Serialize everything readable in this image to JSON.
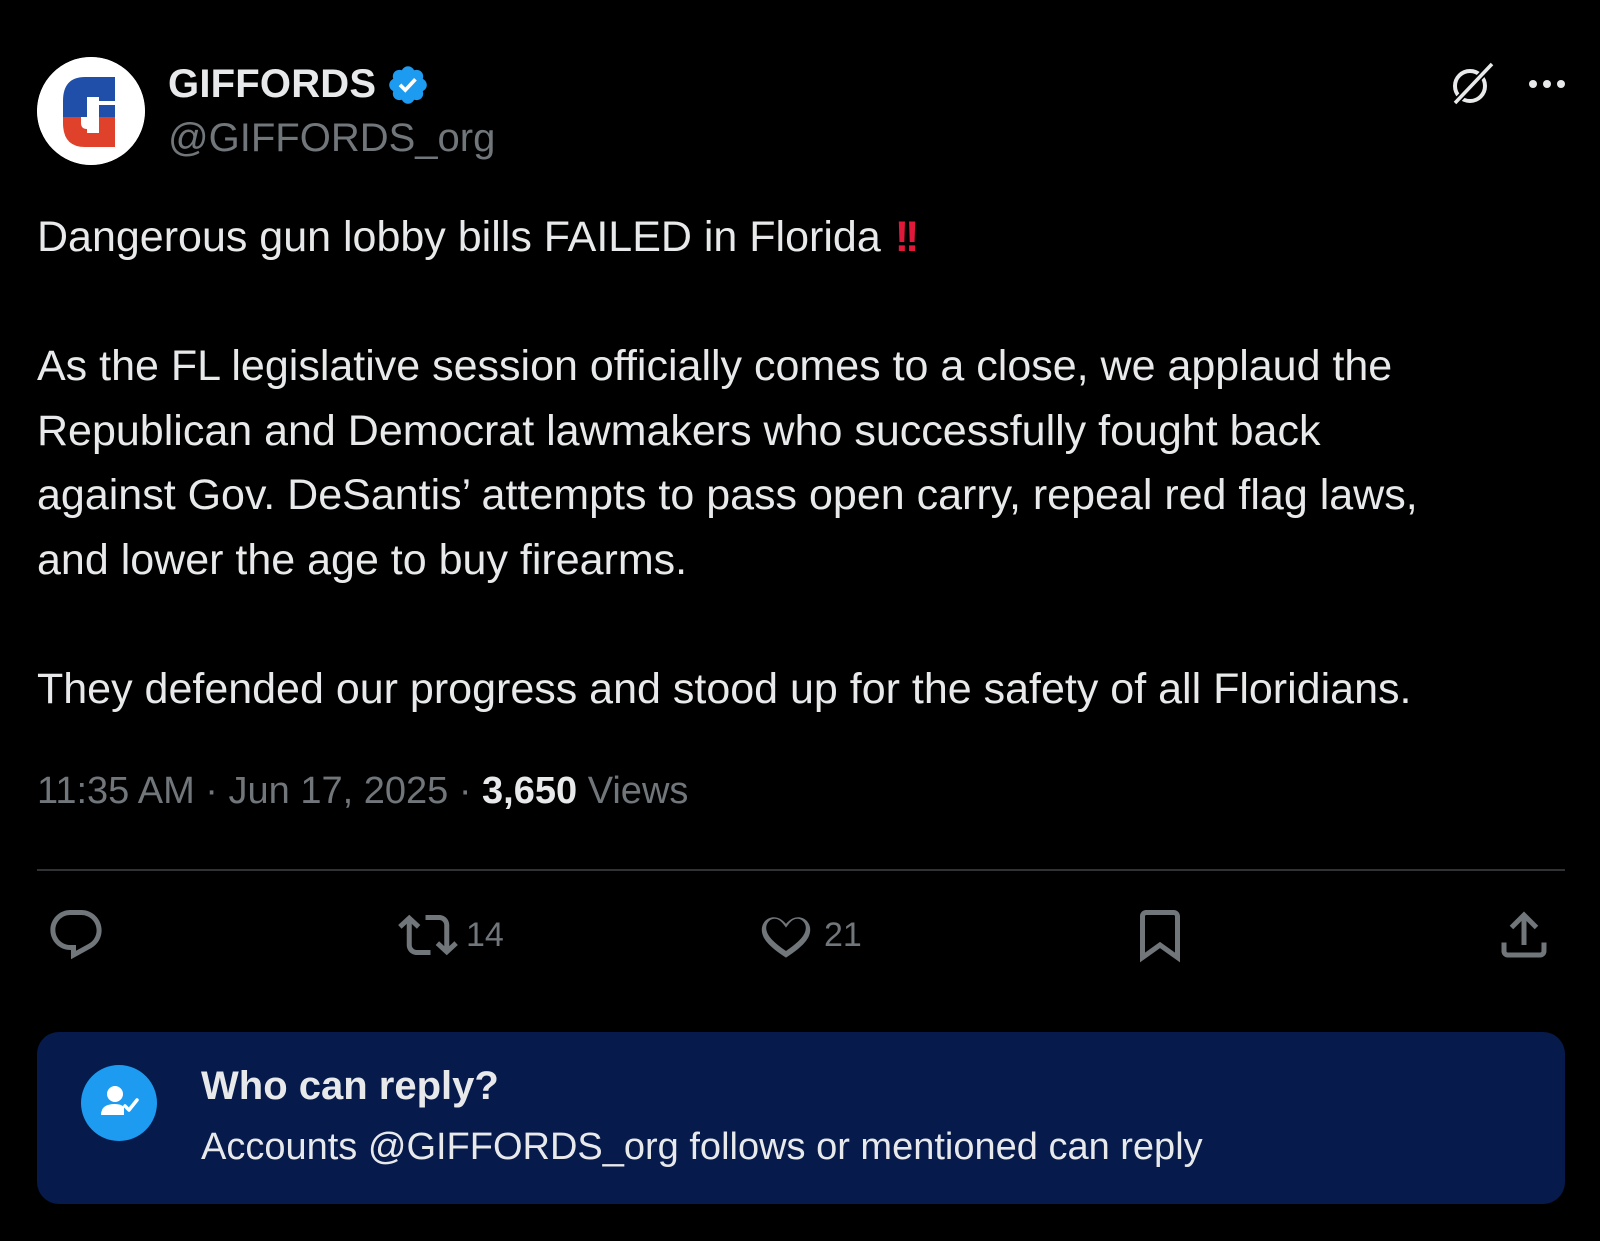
{
  "author": {
    "display_name": "GIFFORDS",
    "handle": "@GIFFORDS_org",
    "avatar_letter": "G",
    "verified": true,
    "verified_color": "#1d9bf0"
  },
  "tweet": {
    "line1": "Dangerous gun lobby bills FAILED in Florida",
    "emoji": "!!",
    "paragraph2": [
      "As the FL legislative session officially comes to a close, we applaud the",
      "Republican and Democrat lawmakers who successfully fought back",
      "against Gov. DeSantis’ attempts to pass open carry, repeal red flag laws,",
      "and lower the age to buy firearms."
    ],
    "paragraph3": "They defended our progress and stood up for the safety of all Floridians."
  },
  "meta": {
    "time": "11:35 AM",
    "separator": "·",
    "date": "Jun 17, 2025",
    "views_count": "3,650",
    "views_label": "Views"
  },
  "actions": {
    "reply_count": "",
    "retweet_count": "14",
    "like_count": "21"
  },
  "reply_settings": {
    "title": "Who can reply?",
    "description": "Accounts @GIFFORDS_org follows or mentioned can reply"
  },
  "icons": {
    "top_right": [
      "grok-icon",
      "more-icon"
    ],
    "action_bar": [
      "reply-icon",
      "retweet-icon",
      "like-icon",
      "bookmark-icon",
      "share-icon"
    ],
    "reply_box": "person-check-icon"
  },
  "colors": {
    "background": "#000000",
    "text_primary": "#e7e9ea",
    "text_secondary": "#71767b",
    "accent": "#1d9bf0",
    "reply_box_bg": "#061a4b",
    "emoji_red": "#e0193a"
  }
}
